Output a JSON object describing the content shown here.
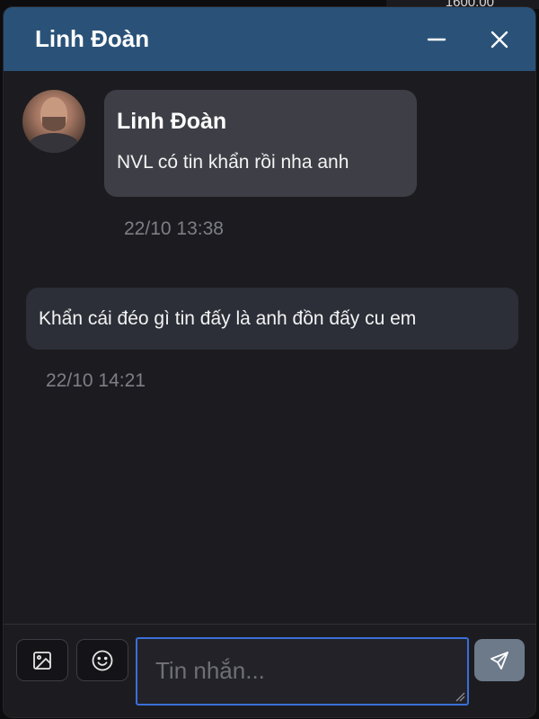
{
  "background_app": {
    "price_text": "1600.00"
  },
  "chat": {
    "title": "Linh Đoàn",
    "header_icons": [
      "minimize-icon",
      "close-icon"
    ],
    "colors": {
      "header": "#2a5278",
      "incoming_bubble": "#3e3e46",
      "outgoing_bubble": "#2c2f38",
      "input_focus_border": "#3a6fd8",
      "send_button": "#6c7a8a"
    },
    "messages": [
      {
        "direction": "incoming",
        "sender": "Linh Đoàn",
        "text": "NVL có tin khẩn rồi nha anh",
        "timestamp": "22/10 13:38"
      },
      {
        "direction": "outgoing",
        "text": "Khẩn cái đéo gì tin đấy là anh đồn đấy cu em",
        "timestamp": "22/10 14:21"
      }
    ],
    "composer": {
      "placeholder": "Tin nhắn...",
      "value": "",
      "icons": [
        "image-icon",
        "emoji-icon",
        "send-icon"
      ]
    }
  }
}
